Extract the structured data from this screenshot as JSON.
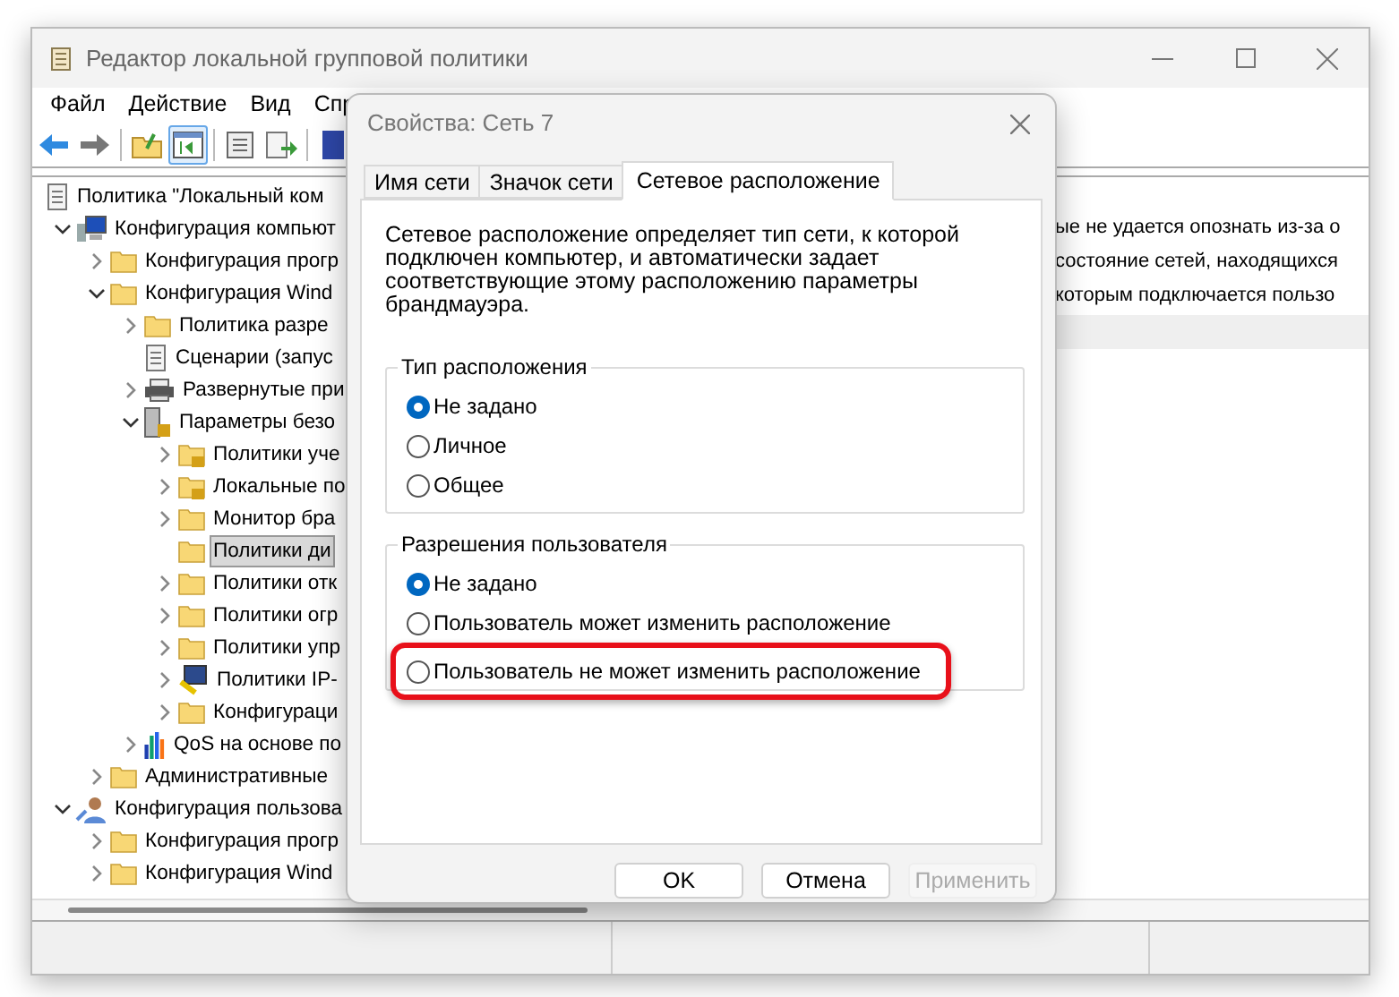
{
  "window": {
    "title": "Редактор локальной групповой политики"
  },
  "menu": [
    "Файл",
    "Действие",
    "Вид",
    "Спр"
  ],
  "toolbar": [
    {
      "kind": "back",
      "selected": false
    },
    {
      "kind": "forward",
      "selected": false
    },
    {
      "kind": "up",
      "selected": false
    },
    {
      "kind": "pane",
      "selected": true
    },
    {
      "kind": "properties",
      "selected": false
    },
    {
      "kind": "export",
      "selected": false
    },
    {
      "kind": "help",
      "selected": false
    }
  ],
  "tree": [
    {
      "label": "Политика \"Локальный ком",
      "kind": "policy",
      "children": [
        {
          "label": "Конфигурация компьют",
          "kind": "computer",
          "expanded": true,
          "children": [
            {
              "label": "Конфигурация прогр",
              "kind": "folder",
              "expanded": false
            },
            {
              "label": "Конфигурация Wind",
              "kind": "folder",
              "expanded": true,
              "children": [
                {
                  "label": "Политика разре",
                  "kind": "folder",
                  "expanded": false
                },
                {
                  "label": "Сценарии (запус",
                  "kind": "script"
                },
                {
                  "label": "Развернутые при",
                  "kind": "printer",
                  "expanded": false
                },
                {
                  "label": "Параметры безо",
                  "kind": "secure",
                  "expanded": true,
                  "children": [
                    {
                      "label": "Политики уче",
                      "kind": "lockfolder",
                      "expanded": false
                    },
                    {
                      "label": "Локальные по",
                      "kind": "lockfolder",
                      "expanded": false
                    },
                    {
                      "label": "Монитор бра",
                      "kind": "folder",
                      "expanded": false
                    },
                    {
                      "label": "Политики ди",
                      "kind": "folder",
                      "selected": true
                    },
                    {
                      "label": "Политики отк",
                      "kind": "folder",
                      "expanded": false
                    },
                    {
                      "label": "Политики огр",
                      "kind": "folder",
                      "expanded": false
                    },
                    {
                      "label": "Политики упр",
                      "kind": "folder",
                      "expanded": false
                    },
                    {
                      "label": "Политики IP-",
                      "kind": "ipsec",
                      "expanded": false
                    },
                    {
                      "label": "Конфигураци",
                      "kind": "folder",
                      "expanded": false
                    }
                  ]
                },
                {
                  "label": "QoS на основе по",
                  "kind": "chart",
                  "expanded": false
                }
              ]
            },
            {
              "label": "Административные",
              "kind": "folder",
              "expanded": false
            }
          ]
        },
        {
          "label": "Конфигурация пользова",
          "kind": "user",
          "expanded": true,
          "children": [
            {
              "label": "Конфигурация прогр",
              "kind": "folder",
              "expanded": false
            },
            {
              "label": "Конфигурация Wind",
              "kind": "folder",
              "expanded": false
            }
          ]
        }
      ]
    }
  ],
  "details": [
    "ые не удается опознать из-за о",
    "состояние сетей, находящихся",
    "которым подключается пользо"
  ],
  "dialog": {
    "title": "Свойства: Сеть 7",
    "tabs": [
      {
        "label": "Имя сети",
        "selected": false
      },
      {
        "label": "Значок сети",
        "selected": false
      },
      {
        "label": "Сетевое расположение",
        "selected": true
      }
    ],
    "description": "Сетевое расположение определяет тип сети, к которой подключен компьютер, и автоматически задает соответствующие этому расположению параметры брандмауэра.",
    "groups": [
      {
        "title": "Тип расположения",
        "options": [
          {
            "label": "Не задано",
            "selected": true,
            "highlighted": false
          },
          {
            "label": "Личное",
            "selected": false,
            "highlighted": false
          },
          {
            "label": "Общее",
            "selected": false,
            "highlighted": false
          }
        ]
      },
      {
        "title": "Разрешения пользователя",
        "options": [
          {
            "label": "Не задано",
            "selected": true,
            "highlighted": false
          },
          {
            "label": "Пользователь может изменить расположение",
            "selected": false,
            "highlighted": false
          },
          {
            "label": "Пользователь не может изменить расположение",
            "selected": false,
            "highlighted": true
          }
        ]
      }
    ],
    "buttons": [
      {
        "label": "OK",
        "disabled": false
      },
      {
        "label": "Отмена",
        "disabled": false
      },
      {
        "label": "Применить",
        "disabled": true
      }
    ]
  }
}
